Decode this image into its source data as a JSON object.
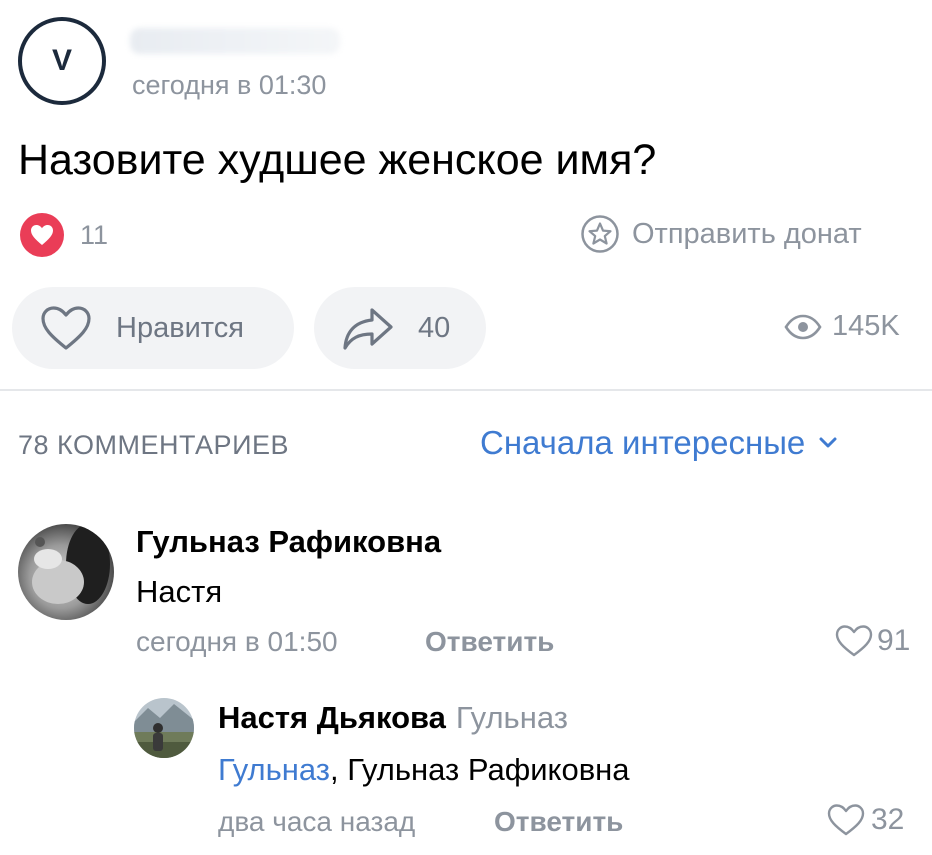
{
  "post": {
    "avatar_letter": "V",
    "time": "сегодня в 01:30",
    "title": "Назовите худшее женское имя?",
    "reactions_count": "11",
    "donate_label": "Отправить донат",
    "like_label": "Нравится",
    "shares_count": "40",
    "views_count": "145K"
  },
  "comments_header": {
    "count_label": "78 КОММЕНТАРИЕВ",
    "sort_label": "Сначала интересные"
  },
  "comments": [
    {
      "author": "Гульназ Рафиковна",
      "text": "Настя",
      "time": "сегодня в 01:50",
      "reply_label": "Ответить",
      "likes": "91",
      "replies": [
        {
          "author": "Настя Дьякова",
          "reply_to": "Гульназ",
          "mention": "Гульназ",
          "text": ", Гульназ Рафиковна",
          "time": "два часа назад",
          "reply_label": "Ответить",
          "likes": "32"
        }
      ]
    }
  ],
  "colors": {
    "heart_reaction": "#ea3d57",
    "link_blue": "#3f7bd1",
    "secondary_text": "#8d949e",
    "pill_bg": "#f2f3f5"
  },
  "icons": {
    "reaction": "heart-filled-icon",
    "donate": "star-circle-icon",
    "like": "heart-outline-icon",
    "share": "share-arrow-icon",
    "views": "eye-icon",
    "sort": "chevron-down-icon"
  }
}
